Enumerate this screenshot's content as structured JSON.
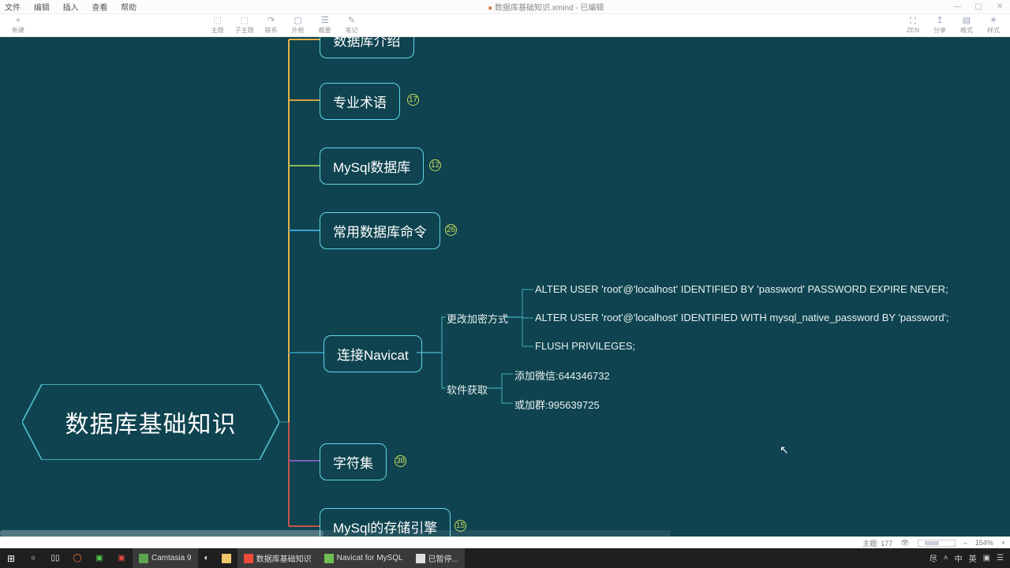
{
  "window": {
    "filename": "数据库基础知识.xmind",
    "status_suffix": " - 已编辑",
    "menu": [
      "文件",
      "编辑",
      "插入",
      "查看",
      "帮助"
    ]
  },
  "toolbar": {
    "left": [
      {
        "name": "create",
        "label": "新建",
        "glyph": "+"
      }
    ],
    "center": [
      {
        "name": "theme",
        "label": "主题",
        "glyph": "⬚"
      },
      {
        "name": "subtopic",
        "label": "子主题",
        "glyph": "⬚"
      },
      {
        "name": "relation",
        "label": "联系",
        "glyph": "↷"
      },
      {
        "name": "summary",
        "label": "外框",
        "glyph": "▢"
      },
      {
        "name": "boundary",
        "label": "概要",
        "glyph": "☰"
      },
      {
        "name": "note",
        "label": "笔记",
        "glyph": "✎"
      }
    ],
    "right": [
      {
        "name": "fit",
        "label": "ZEN",
        "glyph": "⛶"
      },
      {
        "name": "share",
        "label": "分享",
        "glyph": "↥"
      },
      {
        "name": "format",
        "label": "格式",
        "glyph": "▤"
      },
      {
        "name": "style",
        "label": "样式",
        "glyph": "☀"
      }
    ]
  },
  "mindmap": {
    "root": "数据库基础知识",
    "branches": [
      {
        "id": "b0",
        "label": "数据库介绍",
        "count": null,
        "color": "#e6b24a"
      },
      {
        "id": "b1",
        "label": "专业术语",
        "count": "17",
        "color": "#d8a03d"
      },
      {
        "id": "b2",
        "label": "MySql数据库",
        "count": "12",
        "color": "#8fb85a"
      },
      {
        "id": "b3",
        "label": "常用数据库命令",
        "count": "26",
        "color": "#3aa0d8"
      },
      {
        "id": "b4",
        "label": "连接Navicat",
        "count": null,
        "color": "#2f8aa8"
      },
      {
        "id": "b5",
        "label": "字符集",
        "count": "38",
        "color": "#7d5fb0"
      },
      {
        "id": "b6",
        "label": "MySql的存储引擎",
        "count": "15",
        "color": "#c7554f"
      }
    ],
    "navicat": {
      "sub1_label": "更改加密方式",
      "sub2_label": "软件获取",
      "sql1": "ALTER USER 'root'@'localhost' IDENTIFIED BY 'password' PASSWORD EXPIRE NEVER;",
      "sql2": "ALTER USER 'root'@'localhost' IDENTIFIED WITH mysql_native_password BY 'password';",
      "sql3": "FLUSH PRIVILEGES;",
      "contact1": "添加微信:644346732",
      "contact2": "或加群:995639725"
    }
  },
  "statusbar": {
    "topic_count_label": "主题:",
    "topic_count": "177",
    "zoom": "154%"
  },
  "taskbar": {
    "apps": [
      {
        "name": "camtasia",
        "label": "Camtasia 9",
        "color": "#5fa450"
      },
      {
        "name": "chrome",
        "label": "",
        "color": "#ffffff"
      },
      {
        "name": "explorer",
        "label": "",
        "color": "#f0c46b"
      },
      {
        "name": "xmind",
        "label": "数据库基础知识",
        "color": "#ef4b3a"
      },
      {
        "name": "navicat",
        "label": "Navicat for MySQL",
        "color": "#6fbf55"
      },
      {
        "name": "paused",
        "label": "已暂停...",
        "color": "#ffffff"
      }
    ],
    "tray": {
      "notify": "尽",
      "ime_lang": "中",
      "ime_mode": "英",
      "ime_kb": "▣",
      "more": "☰"
    }
  }
}
